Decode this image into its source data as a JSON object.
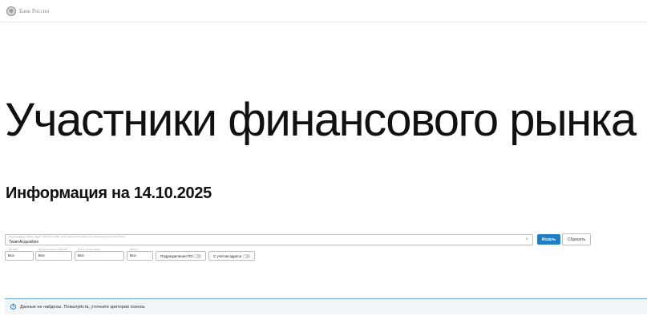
{
  "header": {
    "logo_text": "Банк России"
  },
  "page": {
    "title": "Участники финансового рынка",
    "subtitle": "Информация на 14.10.2025"
  },
  "search": {
    "label": "Наименование (ИНН), адрес, ОГРН или ИНН, регистрационный номер или лицензия регулятора рынка",
    "value": "TwainAcquisition",
    "clear_symbol": "×",
    "find_label": "Искать",
    "reset_label": "Сбросить"
  },
  "filters": [
    {
      "label": "Тип ЛЕЛ",
      "value": "Все"
    },
    {
      "label": "Вид деятельности ЦБ РФ",
      "value": "Все"
    },
    {
      "label": "Статус регистрации",
      "value": "Все"
    },
    {
      "label": "Регион",
      "value": "Все"
    }
  ],
  "toggles": [
    {
      "label": "Подразделения ПО",
      "on": false
    },
    {
      "label": "С учетом адреса",
      "on": false
    }
  ],
  "notice": {
    "icon": "info-icon",
    "text": "Данные не найдены. Пожалуйста, уточните критерии поиска."
  },
  "colors": {
    "accent": "#1f7ec6",
    "notice_border": "#6fa9d6",
    "notice_bg": "#f2f5f7"
  }
}
